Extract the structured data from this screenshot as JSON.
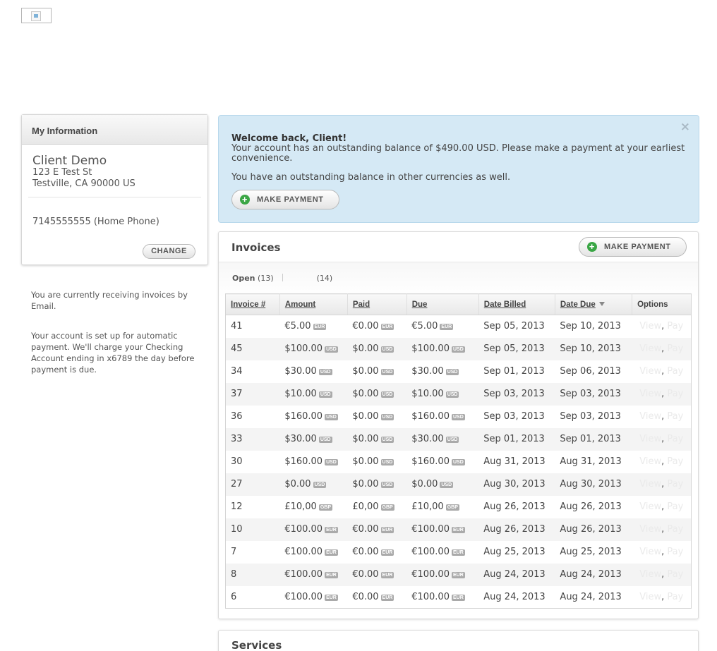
{
  "my_info": {
    "title": "My Information",
    "name": "Client Demo",
    "address1": "123 E Test St",
    "address2": "Testville, CA 90000 US",
    "phone": "7145555555 (Home Phone)",
    "change_label": "CHANGE"
  },
  "notes": {
    "invoice_method": "You are currently receiving invoices by Email.",
    "autopay": "Your account is set up for automatic payment. We'll charge your Checking Account ending in x6789 the day before payment is due."
  },
  "alert": {
    "title": "Welcome back, Client!",
    "message": "Your account has an outstanding balance of $490.00 USD. Please make a payment at your earliest convenience.",
    "message2": "You have an outstanding balance in other currencies as well.",
    "button": "MAKE PAYMENT",
    "close": "×"
  },
  "invoices": {
    "title": "Invoices",
    "button": "MAKE PAYMENT",
    "tabs": {
      "open_label": "Open",
      "open_count": "(13)",
      "other_count": "(14)"
    },
    "columns": [
      "Invoice #",
      "Amount",
      "Paid",
      "Due",
      "Date Billed",
      "Date Due",
      "Options"
    ],
    "rows": [
      {
        "id": "41",
        "amount": "€5.00",
        "ac": "EUR",
        "paid": "€0.00",
        "pc": "EUR",
        "due": "€5.00",
        "dc": "EUR",
        "billed": "Sep 05, 2013",
        "date_due": "Sep 10, 2013",
        "view": "View",
        "pay": "Pay"
      },
      {
        "id": "45",
        "amount": "$100.00",
        "ac": "USD",
        "paid": "$0.00",
        "pc": "USD",
        "due": "$100.00",
        "dc": "USD",
        "billed": "Sep 05, 2013",
        "date_due": "Sep 10, 2013",
        "view": "View",
        "pay": "Pay"
      },
      {
        "id": "34",
        "amount": "$30.00",
        "ac": "USD",
        "paid": "$0.00",
        "pc": "USD",
        "due": "$30.00",
        "dc": "USD",
        "billed": "Sep 01, 2013",
        "date_due": "Sep 06, 2013",
        "view": "View",
        "pay": "Pay"
      },
      {
        "id": "37",
        "amount": "$10.00",
        "ac": "USD",
        "paid": "$0.00",
        "pc": "USD",
        "due": "$10.00",
        "dc": "USD",
        "billed": "Sep 03, 2013",
        "date_due": "Sep 03, 2013",
        "view": "View",
        "pay": "Pay"
      },
      {
        "id": "36",
        "amount": "$160.00",
        "ac": "USD",
        "paid": "$0.00",
        "pc": "USD",
        "due": "$160.00",
        "dc": "USD",
        "billed": "Sep 03, 2013",
        "date_due": "Sep 03, 2013",
        "view": "View",
        "pay": "Pay"
      },
      {
        "id": "33",
        "amount": "$30.00",
        "ac": "USD",
        "paid": "$0.00",
        "pc": "USD",
        "due": "$30.00",
        "dc": "USD",
        "billed": "Sep 01, 2013",
        "date_due": "Sep 01, 2013",
        "view": "View",
        "pay": "Pay"
      },
      {
        "id": "30",
        "amount": "$160.00",
        "ac": "USD",
        "paid": "$0.00",
        "pc": "USD",
        "due": "$160.00",
        "dc": "USD",
        "billed": "Aug 31, 2013",
        "date_due": "Aug 31, 2013",
        "view": "View",
        "pay": "Pay"
      },
      {
        "id": "27",
        "amount": "$0.00",
        "ac": "USD",
        "paid": "$0.00",
        "pc": "USD",
        "due": "$0.00",
        "dc": "USD",
        "billed": "Aug 30, 2013",
        "date_due": "Aug 30, 2013",
        "view": "View",
        "pay": "Pay"
      },
      {
        "id": "12",
        "amount": "£10,00",
        "ac": "GBP",
        "paid": "£0,00",
        "pc": "GBP",
        "due": "£10,00",
        "dc": "GBP",
        "billed": "Aug 26, 2013",
        "date_due": "Aug 26, 2013",
        "view": "View",
        "pay": "Pay"
      },
      {
        "id": "10",
        "amount": "€100.00",
        "ac": "EUR",
        "paid": "€0.00",
        "pc": "EUR",
        "due": "€100.00",
        "dc": "EUR",
        "billed": "Aug 26, 2013",
        "date_due": "Aug 26, 2013",
        "view": "View",
        "pay": "Pay"
      },
      {
        "id": "7",
        "amount": "€100.00",
        "ac": "EUR",
        "paid": "€0.00",
        "pc": "EUR",
        "due": "€100.00",
        "dc": "EUR",
        "billed": "Aug 25, 2013",
        "date_due": "Aug 25, 2013",
        "view": "View",
        "pay": "Pay"
      },
      {
        "id": "8",
        "amount": "€100.00",
        "ac": "EUR",
        "paid": "€0.00",
        "pc": "EUR",
        "due": "€100.00",
        "dc": "EUR",
        "billed": "Aug 24, 2013",
        "date_due": "Aug 24, 2013",
        "view": "View",
        "pay": "Pay"
      },
      {
        "id": "6",
        "amount": "€100.00",
        "ac": "EUR",
        "paid": "€0.00",
        "pc": "EUR",
        "due": "€100.00",
        "dc": "EUR",
        "billed": "Aug 24, 2013",
        "date_due": "Aug 24, 2013",
        "view": "View",
        "pay": "Pay"
      }
    ]
  },
  "services": {
    "title": "Services"
  },
  "colors": {
    "alert_bg": "#d5e9f5",
    "plus_green": "#3aa645",
    "stripe": "#f4f4f4"
  },
  "icons": {
    "logo": "broken-image-icon",
    "plus": "plus-circle-icon",
    "close": "close-icon",
    "sort": "sort-down-icon"
  }
}
